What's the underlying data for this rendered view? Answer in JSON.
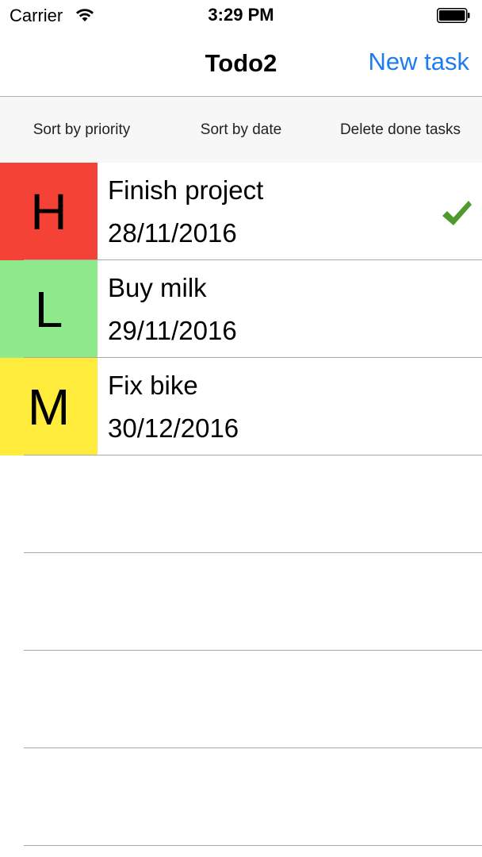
{
  "status_bar": {
    "carrier": "Carrier",
    "time": "3:29 PM"
  },
  "nav": {
    "title": "Todo2",
    "new_task": "New task"
  },
  "toolbar": {
    "sort_priority": "Sort by priority",
    "sort_date": "Sort by date",
    "delete_done": "Delete done tasks"
  },
  "colors": {
    "high": "#f44336",
    "low": "#8fea8b",
    "medium": "#ffeb3b",
    "accent": "#1e7cf0",
    "check": "#4f9a2f"
  },
  "tasks": [
    {
      "priority": "H",
      "title": "Finish project",
      "date": "28/11/2016",
      "done": true
    },
    {
      "priority": "L",
      "title": "Buy milk",
      "date": "29/11/2016",
      "done": false
    },
    {
      "priority": "M",
      "title": "Fix bike",
      "date": "30/12/2016",
      "done": false
    }
  ]
}
